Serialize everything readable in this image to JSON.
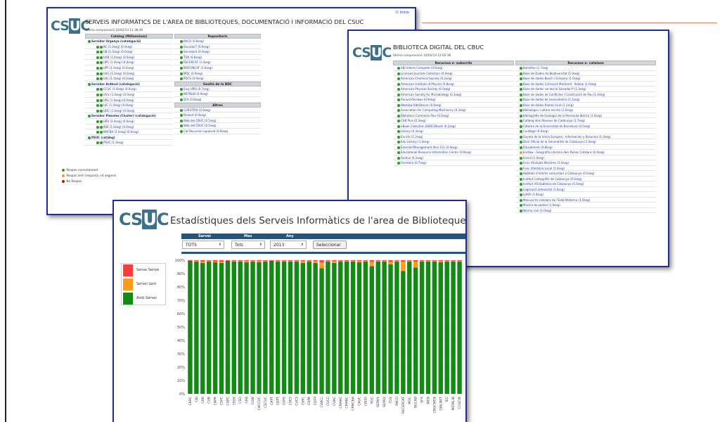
{
  "logo_text": {
    "pre": "CS",
    "mid": "U",
    "post": "C"
  },
  "window_serveis": {
    "title": "SERVEIS INFORMÀTICS DE L'AREA DE BIBLIOTEQUES, DOCUMENTACIÓ I INFORMACIÓ DEL CSUC",
    "subtitle": "Última comprovació 10/02/14 11:38:46",
    "toplink": "⓪ Inicio",
    "left_header": "Catàleg (Millennium)",
    "left_rows": [
      {
        "text": "Servidor Organya (catalogació)",
        "group": true,
        "status": "green"
      },
      {
        "text": "BC (1.0seg) (0.0seg)",
        "status": "green"
      },
      {
        "text": "UB (1.0seg) (0.0seg)",
        "status": "green"
      },
      {
        "text": "UAB (1.0seg) (0.0seg)",
        "status": "green"
      },
      {
        "text": "UPC (1.0seg) (0.0seg)",
        "status": "green"
      },
      {
        "text": "UPF (1.0seg) (0.0seg)",
        "status": "green"
      },
      {
        "text": "UdG (1.0seg) (0.0seg)",
        "status": "green"
      },
      {
        "text": "UdL (1.0seg) (0.0seg)",
        "status": "green"
      },
      {
        "text": "Servidor Ardèvol (catalogació)",
        "group": true,
        "status": "green"
      },
      {
        "text": "CCUC (1.0seg) (0.0seg)",
        "status": "green"
      },
      {
        "text": "UVic (1.0seg) (0.0seg)",
        "status": "green"
      },
      {
        "text": "URL (1.0seg) (0.0seg)",
        "status": "green"
      },
      {
        "text": "UIC (1.0seg) (0.0seg)",
        "status": "green"
      },
      {
        "text": "UOC (1.0seg) (0.0seg)",
        "status": "green"
      },
      {
        "text": "Servidor Planoles (Cluster) (catalogació)",
        "group": true,
        "status": "green"
      },
      {
        "text": "URV (1.0seg) (0.0seg)",
        "status": "green"
      },
      {
        "text": "IRIE (1.0seg) (0.0seg)",
        "status": "green"
      },
      {
        "text": "MACBA (1.0seg) (0.0seg)",
        "status": "green"
      },
      {
        "text": "PSUC (catàleg)",
        "group": true,
        "status": "green"
      },
      {
        "text": "PSUC (1.0seg)",
        "status": "green"
      }
    ],
    "right_header": "Repositoris",
    "right_rows": [
      {
        "text": "RACO (0.8seg)",
        "status": "green"
      },
      {
        "text": "ServidorT (0.9seg)",
        "status": "green"
      },
      {
        "text": "ServidorS (0.9seg)",
        "status": "green"
      },
      {
        "text": "TDX (0.8seg)",
        "status": "green"
      },
      {
        "text": "RECERCAT (1.0seg)",
        "status": "green"
      },
      {
        "text": "MDCONCAT (1.0seg)",
        "status": "green"
      },
      {
        "text": "MDC (0.9seg)",
        "status": "green"
      },
      {
        "text": "PDCS (0.9seg)",
        "status": "green"
      }
    ],
    "right_header2": "Gestió de la BDC",
    "right_rows2": [
      {
        "text": "Eina UPIS (0.7seg)",
        "status": "green"
      },
      {
        "text": "METALIB (0.9seg)",
        "status": "green"
      },
      {
        "text": "SFX (0.8seg)",
        "status": "green"
      }
    ],
    "right_header3": "Altres",
    "right_rows3": [
      {
        "text": "CURUTRIX (0.6seg)",
        "status": "green"
      },
      {
        "text": "Dialnet (0.9seg)",
        "status": "green"
      },
      {
        "text": "Web del CBUC (0.5seg)",
        "status": "green"
      },
      {
        "text": "Web del CBUC (0.5seg)",
        "status": "green"
      },
      {
        "text": "Cat Recursos Lupaciod (0.8seg)",
        "status": "green"
      }
    ],
    "legend": [
      {
        "text": "Respon correctament",
        "status": "green"
      },
      {
        "text": "Respon lent (resposta >4 segons)",
        "status": "orange"
      },
      {
        "text": "No Respon",
        "status": "red"
      }
    ]
  },
  "window_bdc": {
    "title": "BIBLIOTECA DIGITAL DEL CBUC",
    "subtitle": "Última comprovació 10/02/14 12:02:36",
    "left_header": "Recursos e- subscrits",
    "left_rows": [
      "ABI Inform Complete (0.6seg)",
      "Licensed Journals Collection (0.0seg)",
      "American Chemical Society (0.2seg)",
      "American Institute of Physics (0.8seg)",
      "American Physical Society (0.0seg)",
      "American Society for Microbiology (0.3seg)",
      "Annual Reviews (0.9seg)",
      "Westlaw Bibliotecas (0.6seg)",
      "Association for Computing Machinery (0.3seg)",
      "Biblioteca Commons Plus (0.0seg)",
      "CAB Plus (0.3seg)",
      "eBook Collection (EBSCOhost) (0.2seg)",
      "Library (0.3seg)",
      "Enrichi (1.2seg)",
      "Edu Library (1.0seg)",
      "Emerald Management Xtra 111 (0.0seg)",
      "Educational Resource Information Center (0.9seg)",
      "Factiva (0.2seg)",
      "Ferretera (0.7seg)"
    ],
    "right_header": "Recursos e- catalans",
    "right_rows": [
      {
        "text": "Bulletfax (1.7seg)",
        "status": "green"
      },
      {
        "text": "Base de Dades de Biodiversitat (1.0seg)",
        "status": "green"
      },
      {
        "text": "Base de dades Bosch i Gimpera (1.0seg)",
        "status": "green"
      },
      {
        "text": "Base de dades Col·lecció Martorell - Solano (1.0seg)",
        "status": "green"
      },
      {
        "text": "Base de dades col·lecció Salvador P (1.0seg)",
        "status": "green"
      },
      {
        "text": "Base de dades de Conflictes i Construcció de Pau (1.0seg)",
        "status": "green"
      },
      {
        "text": "Base de dades de Lexicometria (1.1seg)",
        "status": "green"
      },
      {
        "text": "Base de dades Ramon Llull (1.1seg)",
        "status": "green"
      },
      {
        "text": "Bibliologia i cultura escrita (1.0seg)",
        "status": "green"
      },
      {
        "text": "Bibliografia de Geologia de la Península Ibèrica (1.0seg)",
        "status": "green"
      },
      {
        "text": "Catàleg dels Ateneus de Catalunya (1.7seg)",
        "status": "green"
      },
      {
        "text": "Càtedra de la Universitat de Barcelona (0.5seg)",
        "status": "green"
      },
      {
        "text": "Cuidatge (0.0seg)",
        "status": "green"
      },
      {
        "text": "Gaceta de la Unión Europea - Información y Recursos (1.0seg)",
        "status": "green"
      },
      {
        "text": "Diari Oficial de la Generalitat de Catalunya (1.0seg)",
        "status": "green"
      },
      {
        "text": "Educalment (0.8seg)",
        "status": "green"
      },
      {
        "text": "Endlaw - Geografia Literària dels Països Catalans (0.0seg)",
        "status": "orange"
      },
      {
        "text": "Enecil (1.0seg)",
        "status": "green"
      },
      {
        "text": "Fons d'Estudis Maritims (1.0seg)",
        "status": "green"
      },
      {
        "text": "Fons d'Història Local (1.0seg)",
        "status": "green"
      },
      {
        "text": "Hàbitats d'interès comunitari a Catalunya (0.0seg)",
        "status": "green"
      },
      {
        "text": "Institut Cartogràfic de Catalunya (0.0seg)",
        "status": "green"
      },
      {
        "text": "Institut d'Estadística de Catalunya (1.0seg)",
        "status": "green"
      },
      {
        "text": "Legislació ambiental (1.0seg)",
        "status": "green"
      },
      {
        "text": "LIAVA (1.0seg)",
        "status": "green"
      },
      {
        "text": "Manuscrits catalans de l'Edat Moderna (1.0seg)",
        "status": "green"
      },
      {
        "text": "Música de poetes (1.0seg)",
        "status": "green"
      },
      {
        "text": "Norma civil (1.0seg)",
        "status": "green"
      }
    ]
  },
  "window_stats": {
    "title": "Estadístiques dels Serveis Informàtics de l'area de Biblioteques, D",
    "labels": {
      "servei": "Servei",
      "mes": "Mes",
      "any": "Any"
    },
    "selects": {
      "servei": "TOTS",
      "mes": "Tots",
      "any": "2013"
    },
    "button": "Seleccionar",
    "legend": [
      {
        "text": "Sense Servei",
        "color": "#ff3b3b"
      },
      {
        "text": "Servei Lent",
        "color": "#ff9a1a"
      },
      {
        "text": "Amb Servei",
        "color": "#138a13"
      }
    ]
  },
  "chart_data": {
    "type": "bar",
    "stacked": true,
    "ylim": [
      0,
      100
    ],
    "yticks": [
      "0%",
      "10%",
      "20%",
      "30%",
      "40%",
      "50%",
      "60%",
      "70%",
      "80%",
      "90%",
      "100%"
    ],
    "categories": [
      "CARC",
      "CBI",
      "CAR",
      "CUB",
      "CAPR",
      "CSPC",
      "CUPC",
      "CSUS",
      "CSO",
      "CAB",
      "CUW",
      "CACCUC",
      "CECUC",
      "CAPT",
      "CUPT",
      "CUPS",
      "CUES",
      "CUCS",
      "CURL",
      "CUPA",
      "CUTP",
      "CUACL",
      "CUCC",
      "CUAC",
      "CRMAC",
      "CRMBC",
      "CRMCBA",
      "CAUC",
      "CAUG",
      "RDC",
      "SERV1",
      "SERV2",
      "TDX",
      "RACO",
      "RECERCAT",
      "MDC",
      "BUCAB",
      "SFX",
      "WEB",
      "CBUCWEB",
      "DIALNET",
      "IEC",
      "METALIB",
      "CCUCW"
    ],
    "series": [
      {
        "name": "Amb Servei",
        "color": "#138a13",
        "values": [
          99.5,
          99,
          98,
          99,
          98.5,
          98,
          99.5,
          99,
          99,
          98.5,
          99,
          98.5,
          99,
          99.5,
          99,
          99,
          99,
          99,
          98,
          99,
          98,
          94,
          99,
          98,
          99,
          99,
          99,
          98.5,
          99,
          95.5,
          99,
          99,
          97,
          99,
          92,
          99,
          94.5,
          99,
          99,
          99,
          98.5,
          99,
          99,
          99
        ]
      },
      {
        "name": "Servei Lent",
        "color": "#ff9a1a",
        "values": [
          0,
          0.5,
          1,
          0.5,
          0.5,
          1,
          0,
          0.5,
          0.5,
          1,
          0.5,
          1,
          0.5,
          0,
          0.5,
          0.5,
          0.5,
          0.5,
          1.5,
          0.5,
          1.5,
          4.5,
          0.5,
          1.5,
          0.5,
          0.5,
          0.5,
          1,
          0.5,
          3.5,
          0.5,
          0.5,
          2,
          0.5,
          7,
          0.5,
          4.5,
          0.5,
          0.5,
          0.5,
          1,
          0.5,
          0.5,
          0.5
        ]
      },
      {
        "name": "Sense Servei",
        "color": "#ff3b3b",
        "values": [
          0.5,
          0.5,
          1,
          0.5,
          1,
          1,
          0.5,
          0.5,
          0.5,
          0.5,
          0.5,
          0.5,
          0.5,
          0.5,
          0.5,
          0.5,
          0.5,
          0.5,
          0.5,
          0.5,
          0.5,
          1.5,
          0.5,
          0.5,
          0.5,
          0.5,
          0.5,
          0.5,
          0.5,
          1,
          0.5,
          0.5,
          1,
          0.5,
          1,
          0.5,
          1,
          0.5,
          0.5,
          0.5,
          0.5,
          0.5,
          0.5,
          0.5
        ]
      }
    ]
  }
}
